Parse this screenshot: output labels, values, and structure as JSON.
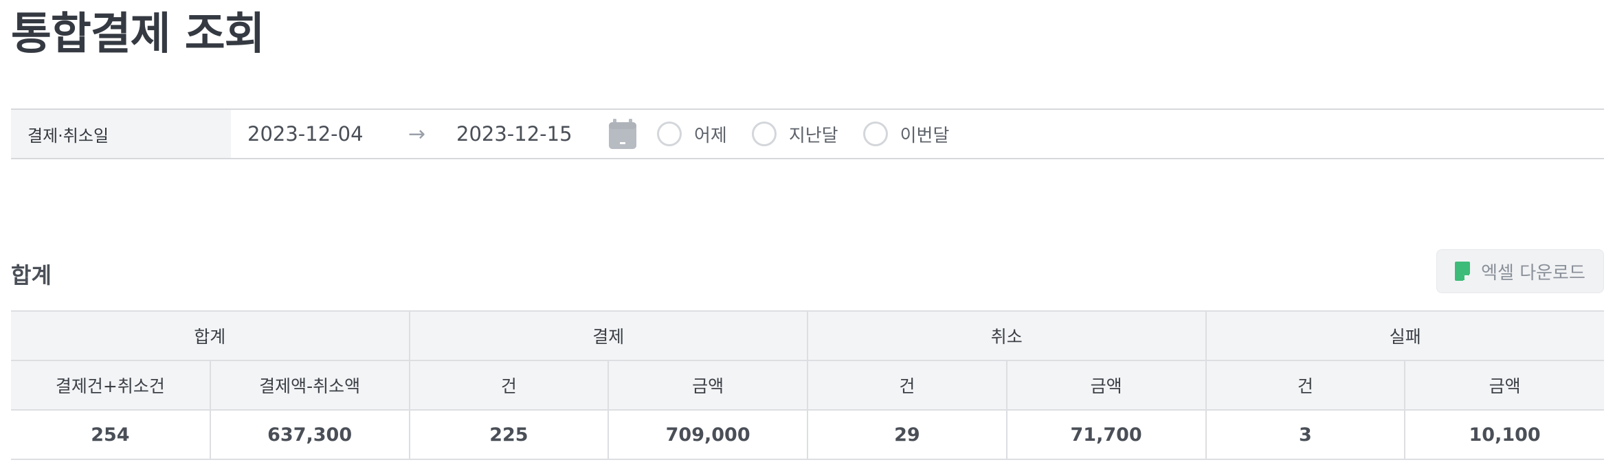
{
  "page": {
    "title": "통합결제 조회"
  },
  "filter": {
    "label": "결제·취소일",
    "date_from": "2023-12-04",
    "arrow": "→",
    "date_to": "2023-12-15",
    "calendar_icon": "calendar-icon",
    "radios": [
      {
        "label": "어제",
        "selected": false
      },
      {
        "label": "지난달",
        "selected": false
      },
      {
        "label": "이번달",
        "selected": false
      }
    ]
  },
  "summary": {
    "section_title": "합계",
    "excel_button_label": "엑셀 다운로드",
    "excel_icon": "excel-file-icon",
    "groups": [
      "합계",
      "결제",
      "취소",
      "실패"
    ],
    "columns": [
      "결제건+취소건",
      "결제액-취소액",
      "건",
      "금액",
      "건",
      "금액",
      "건",
      "금액"
    ],
    "row": [
      "254",
      "637,300",
      "225",
      "709,000",
      "29",
      "71,700",
      "3",
      "10,100"
    ]
  },
  "colors": {
    "header_bg": "#f3f4f6",
    "border": "#dcdee1",
    "excel_green": "#3dbb78",
    "calendar_gray": "#b7bbc2"
  }
}
